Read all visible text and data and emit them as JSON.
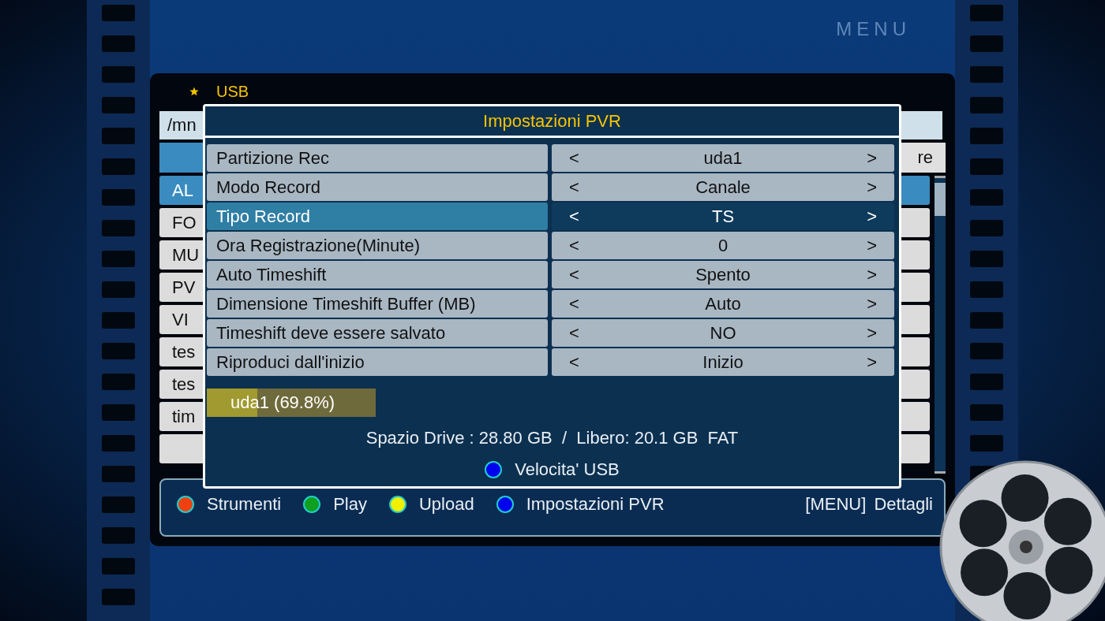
{
  "logo": "MENU",
  "browser": {
    "title": "USB",
    "path": "/mn",
    "header": "re",
    "items": [
      {
        "label": "AL",
        "selected": true
      },
      {
        "label": "FO",
        "selected": false
      },
      {
        "label": "MU",
        "selected": false
      },
      {
        "label": "PV",
        "selected": false
      },
      {
        "label": "VI",
        "selected": false
      },
      {
        "label": "tes",
        "selected": false
      },
      {
        "label": "tes",
        "selected": false
      },
      {
        "label": "tim",
        "selected": false
      },
      {
        "selected": false
      }
    ]
  },
  "dialog": {
    "title": "Impostazioni PVR",
    "settings": [
      {
        "label": "Partizione Rec",
        "prev": "<",
        "value": "uda1",
        "next": ">",
        "selected": false
      },
      {
        "label": "Modo Record",
        "prev": "<",
        "value": "Canale",
        "next": ">",
        "selected": false
      },
      {
        "label": "Tipo Record",
        "prev": "<",
        "value": "TS",
        "next": ">",
        "selected": true
      },
      {
        "label": "Ora Registrazione(Minute)",
        "prev": "<",
        "value": "0",
        "next": ">",
        "selected": false
      },
      {
        "label": "Auto Timeshift",
        "prev": "<",
        "value": "Spento",
        "next": ">",
        "selected": false
      },
      {
        "label": "Dimensione Timeshift Buffer (MB)",
        "prev": "<",
        "value": "Auto",
        "next": ">",
        "selected": false
      },
      {
        "label": "Timeshift deve essere salvato",
        "prev": "<",
        "value": "NO",
        "next": ">",
        "selected": false
      },
      {
        "label": "Riproduci dall'inizio",
        "prev": "<",
        "value": "Inizio",
        "next": ">",
        "selected": false
      }
    ],
    "partition": {
      "label": "uda1 (69.8%)",
      "level": 0.3
    },
    "drive_info": "Spazio Drive : 28.80 GB  /  Libero: 20.1 GB  FAT",
    "speed_key": {
      "label": "Velocita' USB",
      "color": "#0000ee"
    }
  },
  "footer": [
    {
      "label": "Strumenti",
      "color": "#f04010"
    },
    {
      "label": "Play",
      "color": "#10a020"
    },
    {
      "label": "Upload",
      "color": "#f0f000"
    },
    {
      "label": "Impostazioni PVR",
      "color": "#0000ee"
    }
  ],
  "footer_hint": "[MENU]  Dettagli"
}
